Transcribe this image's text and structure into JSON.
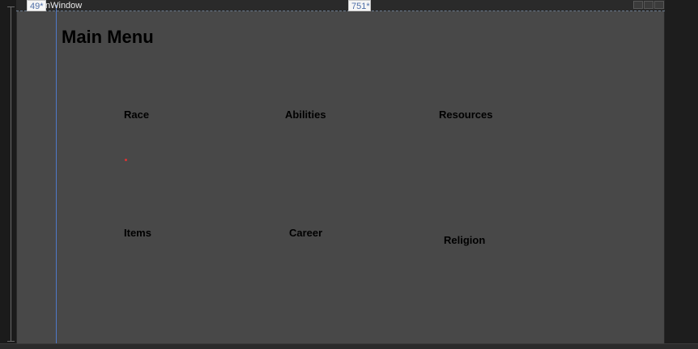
{
  "designer": {
    "column_marker_1": "49*",
    "column_marker_2": "751*",
    "window_label": "nWindow",
    "accent_color": "#4f78c8"
  },
  "main": {
    "title": "Main Menu",
    "buttons": [
      {
        "label": "Race"
      },
      {
        "label": "Abilities"
      },
      {
        "label": "Resources"
      },
      {
        "label": "Items"
      },
      {
        "label": "Career"
      },
      {
        "label": "Religion"
      }
    ]
  }
}
